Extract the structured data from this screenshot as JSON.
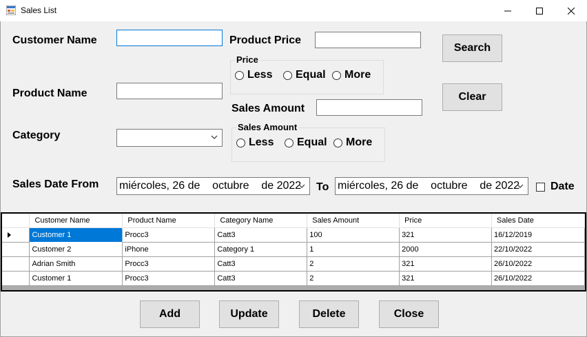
{
  "window": {
    "title": "Sales List"
  },
  "filters": {
    "customer_name_label": "Customer Name",
    "product_name_label": "Product Name",
    "category_label": "Category",
    "product_price_label": "Product Price",
    "sales_amount_label": "Sales Amount",
    "sales_date_from_label": "Sales Date From",
    "to_label": "To",
    "date_checkbox_label": "Date",
    "price_group": {
      "title": "Price",
      "less": "Less",
      "equal": "Equal",
      "more": "More"
    },
    "amount_group": {
      "title": "Sales Amount",
      "less": "Less",
      "equal": "Equal",
      "more": "More"
    },
    "date_from": "miércoles, 26 de    octubre    de 2022",
    "date_to": "miércoles, 26 de    octubre    de 2022"
  },
  "buttons": {
    "search": "Search",
    "clear": "Clear",
    "add": "Add",
    "update": "Update",
    "delete": "Delete",
    "close": "Close"
  },
  "grid": {
    "headers": [
      "Customer Name",
      "Product Name",
      "Category Name",
      "Sales Amount",
      "Price",
      "Sales Date"
    ],
    "rows": [
      [
        "Customer 1",
        "Procc3",
        "Catt3",
        "100",
        "321",
        "16/12/2019"
      ],
      [
        "Customer 2",
        "iPhone",
        "Category 1",
        "1",
        "2000",
        "22/10/2022"
      ],
      [
        "Adrian Smith",
        "Procc3",
        "Catt3",
        "2",
        "321",
        "26/10/2022"
      ],
      [
        "Customer 1",
        "Procc3",
        "Catt3",
        "2",
        "321",
        "26/10/2022"
      ]
    ]
  }
}
